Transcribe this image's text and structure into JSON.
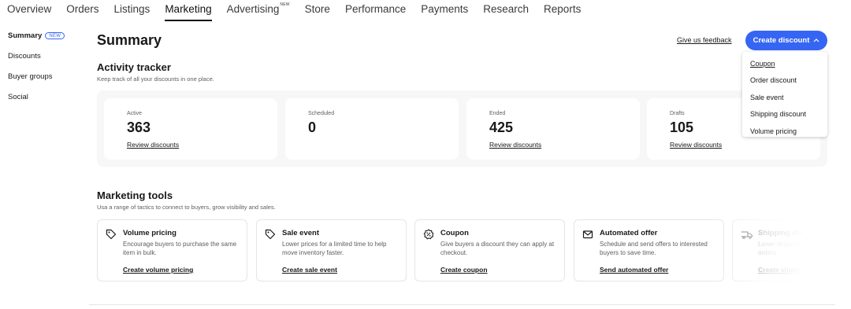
{
  "topnav": {
    "tabs": [
      {
        "label": "Overview"
      },
      {
        "label": "Orders"
      },
      {
        "label": "Listings"
      },
      {
        "label": "Marketing",
        "active": true
      },
      {
        "label": "Advertising",
        "badge": "NEW"
      },
      {
        "label": "Store"
      },
      {
        "label": "Performance"
      },
      {
        "label": "Payments"
      },
      {
        "label": "Research"
      },
      {
        "label": "Reports"
      }
    ]
  },
  "sidebar": {
    "items": [
      {
        "label": "Summary",
        "badge": "NEW"
      },
      {
        "label": "Discounts"
      },
      {
        "label": "Buyer groups"
      },
      {
        "label": "Social"
      }
    ]
  },
  "header": {
    "title": "Summary",
    "feedback": "Give us feedback",
    "create_button": "Create discount",
    "dropdown": [
      "Coupon",
      "Order discount",
      "Sale event",
      "Shipping discount",
      "Volume pricing"
    ]
  },
  "activity": {
    "title": "Activity tracker",
    "subtitle": "Keep track of all your discounts in one place.",
    "stats": [
      {
        "label": "Active",
        "value": "363",
        "link": "Review discounts"
      },
      {
        "label": "Scheduled",
        "value": "0",
        "link": ""
      },
      {
        "label": "Ended",
        "value": "425",
        "link": "Review discounts"
      },
      {
        "label": "Drafts",
        "value": "105",
        "link": "Review discounts"
      }
    ]
  },
  "marketing": {
    "title": "Marketing tools",
    "subtitle": "Usa a range of tactics to connect to buyers, grow visibility and sales.",
    "tools": [
      {
        "title": "Volume pricing",
        "desc": "Encourage buyers to purchase the same item in bulk.",
        "link": "Create volume pricing",
        "icon": "tag-icon"
      },
      {
        "title": "Sale event",
        "desc": "Lower prices for a limited time to help move inventory faster.",
        "link": "Create sale event",
        "icon": "tag-icon"
      },
      {
        "title": "Coupon",
        "desc": "Give buyers a discount they can apply at checkout.",
        "link": "Create coupon",
        "icon": "coupon-badge-icon"
      },
      {
        "title": "Automated offer",
        "desc": "Schedule and send offers to interested buyers to save time.",
        "link": "Send automated offer",
        "icon": "mail-icon"
      },
      {
        "title": "Shipping discount",
        "desc": "Lower shipping costs to encourage larger orders.",
        "link": "Create shipping discount",
        "icon": "shipping-truck-icon"
      }
    ]
  }
}
